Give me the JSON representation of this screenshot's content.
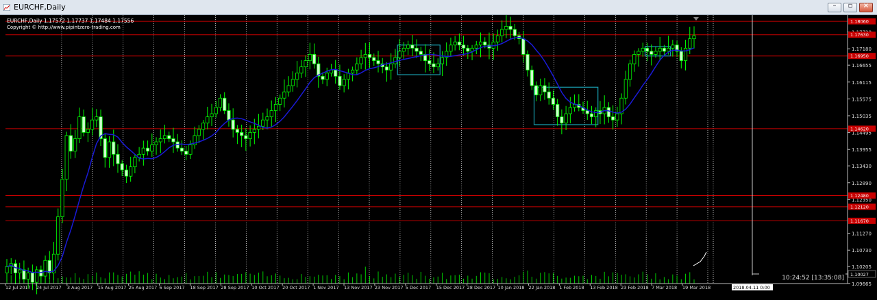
{
  "window": {
    "title": "EURCHF,Daily",
    "buttons": [
      "minimize",
      "restore",
      "close"
    ]
  },
  "header": {
    "line1": "EURCHF,Daily  1.17572 1.17737 1.17484 1.17556",
    "line2": "Copyright © http://www.pipintzero-trading.com"
  },
  "clock": {
    "time": "10:24:52 [13:35:08]",
    "crosshair_date": "2018.04.11 0:00"
  },
  "colors": {
    "background": "#000000",
    "candle_up": "#00ff00",
    "candle_body": "#ccffcc",
    "ma_line": "#1a1ad6",
    "horizontal_level": "#c80000",
    "price_label_bg": "#c80000",
    "box": "#19a2b3",
    "grid": "#ffffff"
  },
  "chart_data": {
    "type": "candlestick",
    "symbol": "EURCHF",
    "timeframe": "Daily",
    "ohlc_last": {
      "open": 1.17572,
      "high": 1.17737,
      "low": 1.17484,
      "close": 1.17556
    },
    "ylim": [
      1.0966,
      1.1826
    ],
    "y_ticks": [
      "1.17720",
      "1.17180",
      "1.16655",
      "1.16115",
      "1.15575",
      "1.15035",
      "1.14495",
      "1.13955",
      "1.13430",
      "1.12890",
      "1.12350",
      "1.11270",
      "1.10730",
      "1.10205",
      "1.09665"
    ],
    "x_labels": [
      "12 Jul 2017",
      "24 Jul 2017",
      "3 Aug 2017",
      "15 Aug 2017",
      "25 Aug 2017",
      "6 Sep 2017",
      "18 Sep 2017",
      "28 Sep 2017",
      "10 Oct 2017",
      "20 Oct 2017",
      "1 Nov 2017",
      "13 Nov 2017",
      "23 Nov 2017",
      "5 Dec 2017",
      "15 Dec 2017",
      "28 Dec 2017",
      "10 Jan 2018",
      "22 Jan 2018",
      "1 Feb 2018",
      "13 Feb 2018",
      "23 Feb 2018",
      "7 Mar 2018",
      "19 Mar 2018"
    ],
    "grid": "vertical dotted",
    "volume_last": "1.10027",
    "horizontal_levels": [
      {
        "price": 1.1806,
        "label": "1.18060"
      },
      {
        "price": 1.1763,
        "label": "1.17630"
      },
      {
        "price": 1.1695,
        "label": "1.16950"
      },
      {
        "price": 1.1462,
        "label": "1.14620"
      },
      {
        "price": 1.1248,
        "label": "1.12480"
      },
      {
        "price": 1.1212,
        "label": "1.12120"
      },
      {
        "price": 1.1167,
        "label": "1.11670"
      }
    ],
    "closes": [
      1.102,
      1.103,
      1.1,
      1.101,
      1.098,
      1.1,
      1.097,
      1.101,
      1.099,
      1.104,
      1.1,
      1.106,
      1.118,
      1.13,
      1.144,
      1.139,
      1.143,
      1.15,
      1.145,
      1.146,
      1.149,
      1.15,
      1.143,
      1.137,
      1.142,
      1.138,
      1.135,
      1.133,
      1.131,
      1.134,
      1.137,
      1.138,
      1.14,
      1.139,
      1.141,
      1.142,
      1.143,
      1.144,
      1.143,
      1.142,
      1.14,
      1.139,
      1.138,
      1.141,
      1.144,
      1.146,
      1.148,
      1.15,
      1.151,
      1.153,
      1.156,
      1.152,
      1.149,
      1.146,
      1.145,
      1.144,
      1.143,
      1.145,
      1.146,
      1.147,
      1.149,
      1.15,
      1.152,
      1.154,
      1.156,
      1.158,
      1.16,
      1.162,
      1.164,
      1.166,
      1.168,
      1.17,
      1.167,
      1.163,
      1.162,
      1.164,
      1.165,
      1.163,
      1.16,
      1.162,
      1.164,
      1.165,
      1.167,
      1.169,
      1.17,
      1.169,
      1.168,
      1.167,
      1.166,
      1.165,
      1.167,
      1.169,
      1.171,
      1.172,
      1.173,
      1.172,
      1.171,
      1.17,
      1.168,
      1.167,
      1.166,
      1.167,
      1.169,
      1.171,
      1.173,
      1.174,
      1.173,
      1.172,
      1.171,
      1.172,
      1.173,
      1.174,
      1.173,
      1.172,
      1.174,
      1.176,
      1.178,
      1.179,
      1.178,
      1.176,
      1.175,
      1.17,
      1.165,
      1.16,
      1.157,
      1.16,
      1.158,
      1.156,
      1.154,
      1.15,
      1.148,
      1.151,
      1.153,
      1.154,
      1.153,
      1.152,
      1.151,
      1.15,
      1.152,
      1.151,
      1.153,
      1.15,
      1.149,
      1.151,
      1.156,
      1.162,
      1.167,
      1.17,
      1.171,
      1.172,
      1.171,
      1.17,
      1.171,
      1.172,
      1.171,
      1.172,
      1.173,
      1.171,
      1.168,
      1.172,
      1.175,
      1.176
    ],
    "boxes": [
      {
        "from_index": 124,
        "to_index": 138,
        "high": 1.1595,
        "low": 1.1475
      },
      {
        "from_index": 92,
        "to_index": 101,
        "high": 1.173,
        "low": 1.1635
      },
      {
        "from_index": 150,
        "to_index": 155,
        "high": 1.1725,
        "low": 1.1695
      }
    ]
  }
}
